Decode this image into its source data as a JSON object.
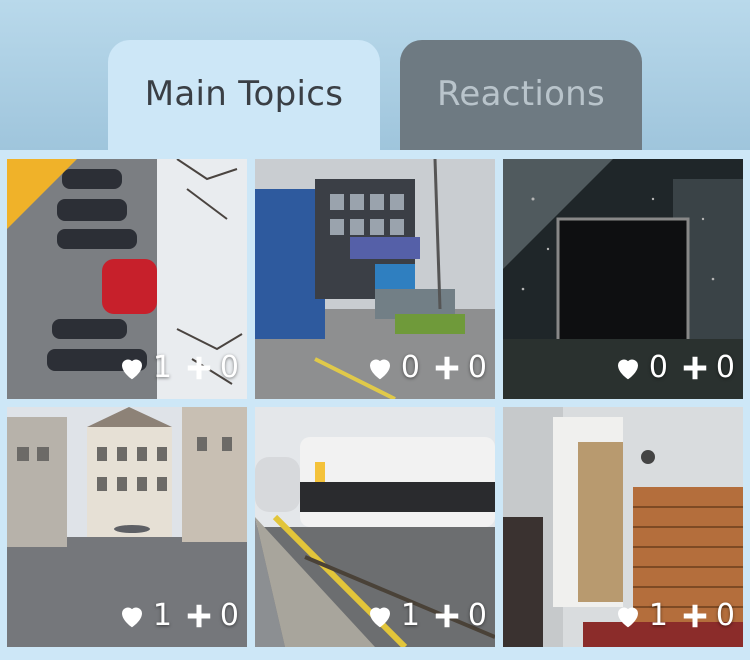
{
  "tabs": {
    "main": "Main Topics",
    "reactions": "Reactions"
  },
  "tiles": [
    {
      "scene": "street-crowd-rotated",
      "likes": "1",
      "plus": "0",
      "highlight": true
    },
    {
      "scene": "sex-shop-building",
      "likes": "0",
      "plus": "0",
      "highlight": false
    },
    {
      "scene": "ecliptic-screen",
      "likes": "0",
      "plus": "0",
      "highlight": false
    },
    {
      "scene": "old-town-square",
      "likes": "1",
      "plus": "0",
      "highlight": false
    },
    {
      "scene": "train-station",
      "likes": "1",
      "plus": "0",
      "highlight": false
    },
    {
      "scene": "apartment-interior",
      "likes": "1",
      "plus": "0",
      "highlight": false
    }
  ],
  "colors": {
    "accent": "#f0b229",
    "active_tab": "#cde7f7",
    "inactive_tab": "#6e7a82"
  },
  "icons": {
    "like": "heart-icon",
    "add": "plus-icon"
  }
}
